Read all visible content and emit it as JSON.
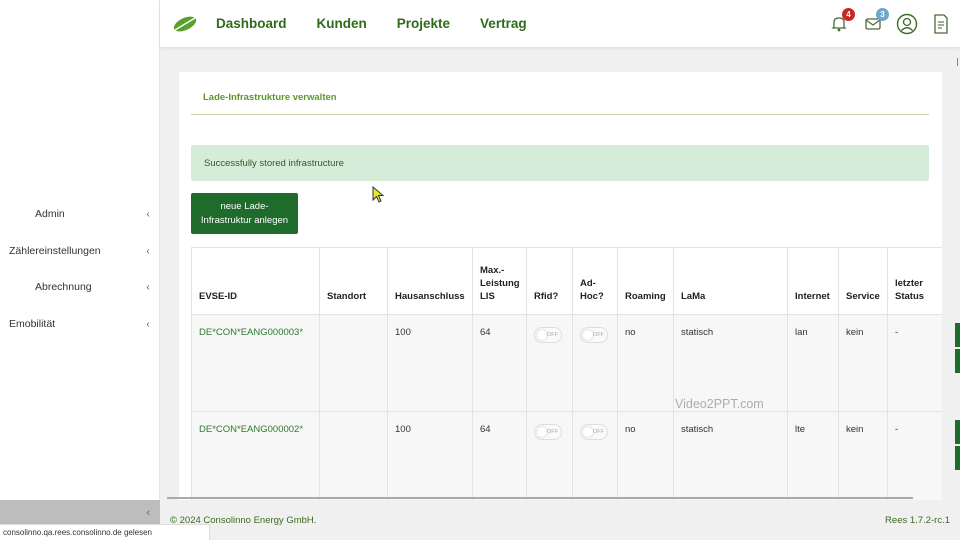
{
  "sidebar": {
    "items": [
      {
        "label": "Admin"
      },
      {
        "label": "Zählereinstellungen"
      },
      {
        "label": "Abrechnung"
      },
      {
        "label": "Emobilität"
      }
    ],
    "chevron": "‹"
  },
  "nav": {
    "links": [
      "Dashboard",
      "Kunden",
      "Projekte",
      "Vertrag"
    ],
    "notifications_count": "4",
    "messages_count": "3"
  },
  "page": {
    "title": "Lade-Infrastrukture verwalten",
    "alert": "Successfully stored infrastructure",
    "new_button": "neue Lade-Infrastruktur anlegen"
  },
  "table": {
    "headers": [
      "EVSE-ID",
      "Standort",
      "Hausanschluss",
      "Max.-Leistung LIS",
      "Rfid?",
      "Ad-Hoc?",
      "Roaming",
      "LaMa",
      "Internet",
      "Service",
      "letzter Status"
    ],
    "toggle_label": "OFF",
    "rows": [
      {
        "evse_id": "DE*CON*EANG000003*",
        "standort": "",
        "hausanschluss": "100",
        "max_leistung": "64",
        "roaming": "no",
        "lama": "statisch",
        "internet": "lan",
        "service": "kein",
        "status": "-"
      },
      {
        "evse_id": "DE*CON*EANG000002*",
        "standort": "",
        "hausanschluss": "100",
        "max_leistung": "64",
        "roaming": "no",
        "lama": "statisch",
        "internet": "lte",
        "service": "kein",
        "status": "-"
      }
    ]
  },
  "footer": {
    "copyright": "© 2024 Consolinno Energy GmbH.",
    "version": "Rees 1.7.2-rc.1"
  },
  "statusbar": "consolinno.qa.rees.consolinno.de gelesen",
  "watermark": "Video2PPT.com",
  "colors": {
    "brand_green": "#1e6b2c",
    "nav_green": "#2f6b1a",
    "alert_bg": "#d5ecd8"
  },
  "icons": [
    "leaf-logo-icon",
    "notification-bell-icon",
    "messages-icon",
    "user-profile-icon",
    "document-icon",
    "chevron-left-icon",
    "mouse-cursor-icon"
  ]
}
